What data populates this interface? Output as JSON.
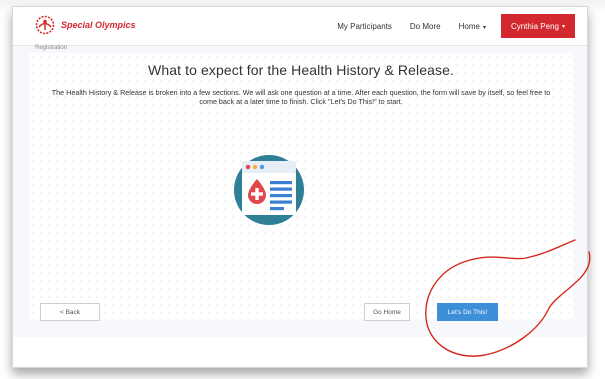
{
  "app": {
    "brand": "Special Olympics",
    "colors": {
      "brand_red": "#d3282e",
      "primary_blue": "#3d8fd8"
    }
  },
  "nav": {
    "items": [
      "My Participants",
      "Do More",
      "Home"
    ],
    "user": "Cynthia Peng"
  },
  "breadcrumb": "Registration",
  "main": {
    "title": "What to expect for the Health History & Release.",
    "description": "The Health History & Release is broken into a few sections. We will ask one question at a time. After each question, the form will save by itself, so feel free to come back at a later time to finish. Click \"Let's Do This!\" to start.",
    "illustration_icon": "medical-form-icon"
  },
  "buttons": {
    "back": "< Back",
    "go_home": "Go Home",
    "start": "Let's Do This!"
  }
}
